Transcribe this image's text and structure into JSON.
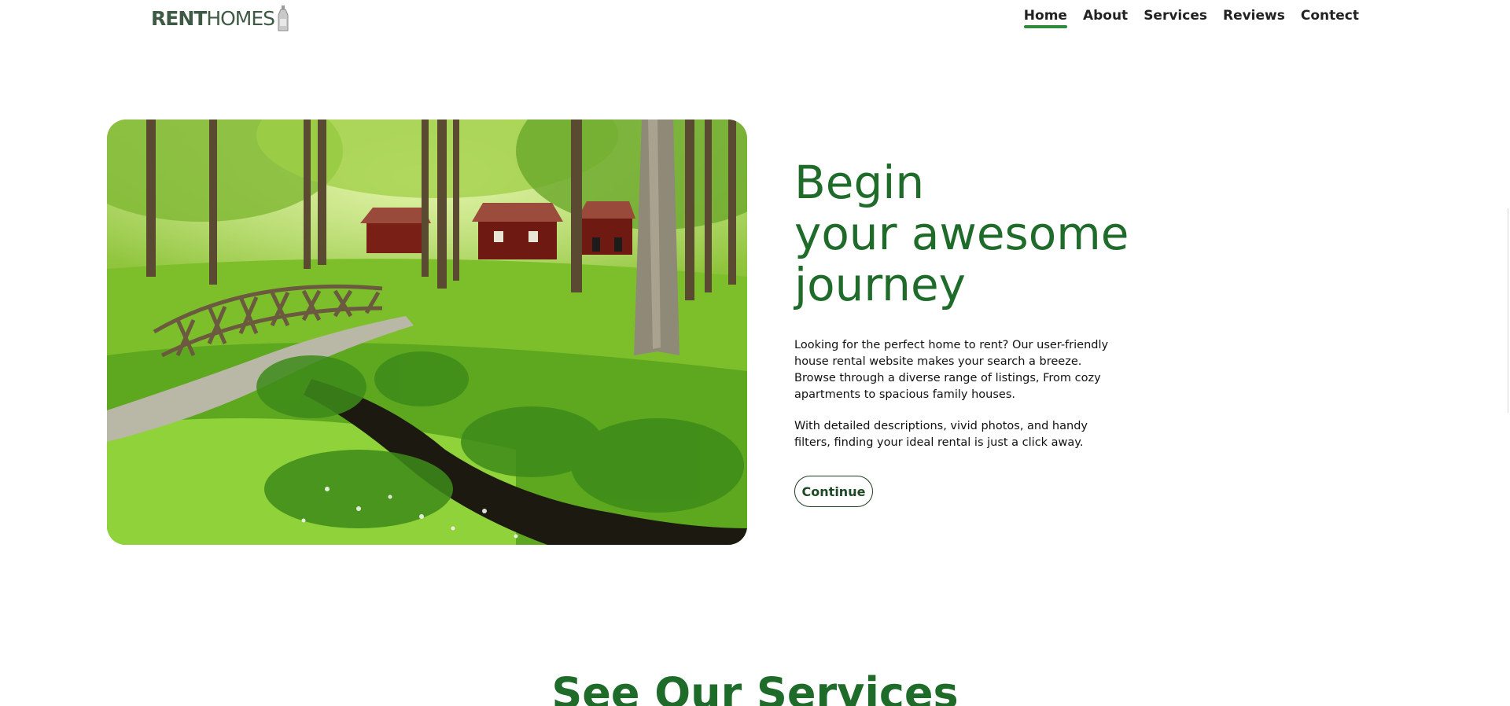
{
  "brand": {
    "rent": "RENT",
    "homes": "HOMES"
  },
  "nav": {
    "items": [
      {
        "label": "Home",
        "active": true
      },
      {
        "label": "About",
        "active": false
      },
      {
        "label": "Services",
        "active": false
      },
      {
        "label": "Reviews",
        "active": false
      },
      {
        "label": "Contect",
        "active": false
      }
    ]
  },
  "hero": {
    "image_name": "forest-cabin-bridge-photo",
    "title_lines": [
      "Begin",
      "your awesome",
      "journey"
    ],
    "paragraph1": "Looking for the perfect home to rent? Our user-friendly house rental website makes your search a breeze. Browse through a diverse range of listings, From cozy apartments to spacious family houses.",
    "paragraph2": "With detailed descriptions, vivid photos, and handy filters, finding your ideal rental is just a click away.",
    "button_label": "Continue"
  },
  "services": {
    "heading": "See Our Services"
  },
  "colors": {
    "accent_green": "#1e6b2a",
    "nav_underline": "#2e8b3e",
    "logo_text": "#3f5a44"
  }
}
